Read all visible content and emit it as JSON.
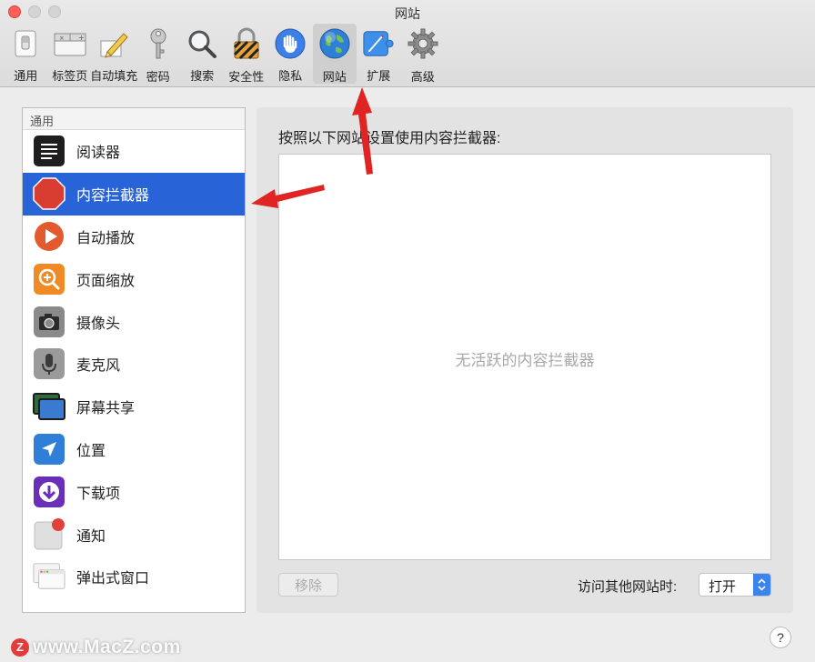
{
  "window": {
    "title": "网站"
  },
  "toolbar": {
    "items": [
      {
        "label": "通用",
        "icon": "switch-icon"
      },
      {
        "label": "标签页",
        "icon": "tabs-icon"
      },
      {
        "label": "自动填充",
        "icon": "pencil-icon"
      },
      {
        "label": "密码",
        "icon": "key-icon"
      },
      {
        "label": "搜索",
        "icon": "search-icon"
      },
      {
        "label": "安全性",
        "icon": "lock-icon"
      },
      {
        "label": "隐私",
        "icon": "hand-icon"
      },
      {
        "label": "网站",
        "icon": "globe-icon"
      },
      {
        "label": "扩展",
        "icon": "puzzle-icon"
      },
      {
        "label": "高级",
        "icon": "gear-icon"
      }
    ],
    "active_index": 7
  },
  "sidebar": {
    "header": "通用",
    "items": [
      {
        "label": "阅读器",
        "icon": "reader-icon"
      },
      {
        "label": "内容拦截器",
        "icon": "stop-icon"
      },
      {
        "label": "自动播放",
        "icon": "play-icon"
      },
      {
        "label": "页面缩放",
        "icon": "zoom-icon"
      },
      {
        "label": "摄像头",
        "icon": "camera-icon"
      },
      {
        "label": "麦克风",
        "icon": "microphone-icon"
      },
      {
        "label": "屏幕共享",
        "icon": "screen-share-icon"
      },
      {
        "label": "位置",
        "icon": "location-icon"
      },
      {
        "label": "下载项",
        "icon": "download-icon"
      },
      {
        "label": "通知",
        "icon": "notification-icon"
      },
      {
        "label": "弹出式窗口",
        "icon": "popup-window-icon"
      }
    ],
    "selected_index": 1
  },
  "panel": {
    "title": "按照以下网站设置使用内容拦截器:",
    "empty_text": "无活跃的内容拦截器",
    "remove_label": "移除",
    "other_sites_label": "访问其他网站时:",
    "other_sites_value": "打开"
  },
  "help": {
    "label": "?"
  },
  "watermark": {
    "badge": "Z",
    "text": "www.MacZ.com"
  },
  "colors": {
    "selection": "#2863d8",
    "annotation_arrow": "#e02424",
    "close_button": "#ff5f57"
  }
}
